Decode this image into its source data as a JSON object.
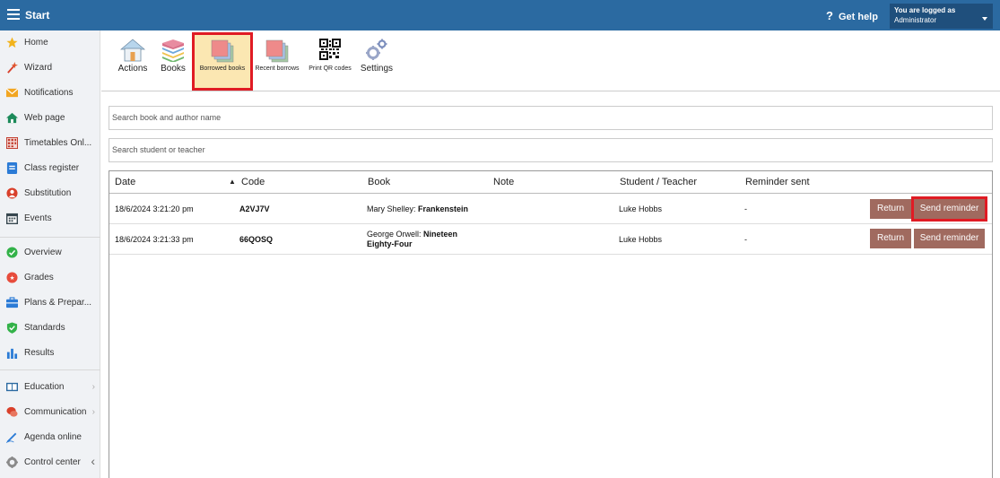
{
  "topbar": {
    "title": "Start",
    "help_label": "Get help",
    "login_line1": "You are logged as",
    "login_line2": "Administrator"
  },
  "sidebar": {
    "items": [
      {
        "label": "Home",
        "icon": "star-icon"
      },
      {
        "label": "Wizard",
        "icon": "wand-icon"
      },
      {
        "label": "Notifications",
        "icon": "envelope-icon"
      },
      {
        "label": "Web page",
        "icon": "home-icon"
      },
      {
        "label": "Timetables Onl...",
        "icon": "timetable-icon"
      },
      {
        "label": "Class register",
        "icon": "register-icon"
      },
      {
        "label": "Substitution",
        "icon": "person-icon"
      },
      {
        "label": "Events",
        "icon": "calendar-icon"
      },
      {
        "label": "Overview",
        "icon": "check-circle-icon"
      },
      {
        "label": "Grades",
        "icon": "grades-icon"
      },
      {
        "label": "Plans & Prepar...",
        "icon": "briefcase-icon"
      },
      {
        "label": "Standards",
        "icon": "shield-icon"
      },
      {
        "label": "Results",
        "icon": "bar-chart-icon"
      },
      {
        "label": "Education",
        "icon": "book-icon"
      },
      {
        "label": "Communication",
        "icon": "chat-icon"
      },
      {
        "label": "Agenda online",
        "icon": "pen-icon"
      },
      {
        "label": "Control center",
        "icon": "gear-icon"
      }
    ]
  },
  "toolbar": {
    "actions": "Actions",
    "books": "Books",
    "borrowed_books": "Borrowed books",
    "recent_borrows": "Recent borrows",
    "print_qr": "Print QR codes",
    "settings": "Settings"
  },
  "search": {
    "book_placeholder": "Search book and author name",
    "student_placeholder": "Search student or teacher"
  },
  "table": {
    "headers": {
      "date": "Date",
      "code": "Code",
      "book": "Book",
      "note": "Note",
      "student": "Student / Teacher",
      "reminder": "Reminder sent"
    },
    "rows": [
      {
        "date": "18/6/2024 3:21:20 pm",
        "code": "A2VJ7V",
        "author": "Mary Shelley: ",
        "title": "Frankenstein",
        "title_line2": "",
        "note": "",
        "student": "Luke Hobbs",
        "reminder": "-",
        "return_label": "Return",
        "reminder_label": "Send reminder"
      },
      {
        "date": "18/6/2024 3:21:33 pm",
        "code": "66QOSQ",
        "author": "George Orwell: ",
        "title": "Nineteen",
        "title_line2": "Eighty-Four",
        "note": "",
        "student": "Luke Hobbs",
        "reminder": "-",
        "return_label": "Return",
        "reminder_label": "Send reminder"
      }
    ]
  }
}
